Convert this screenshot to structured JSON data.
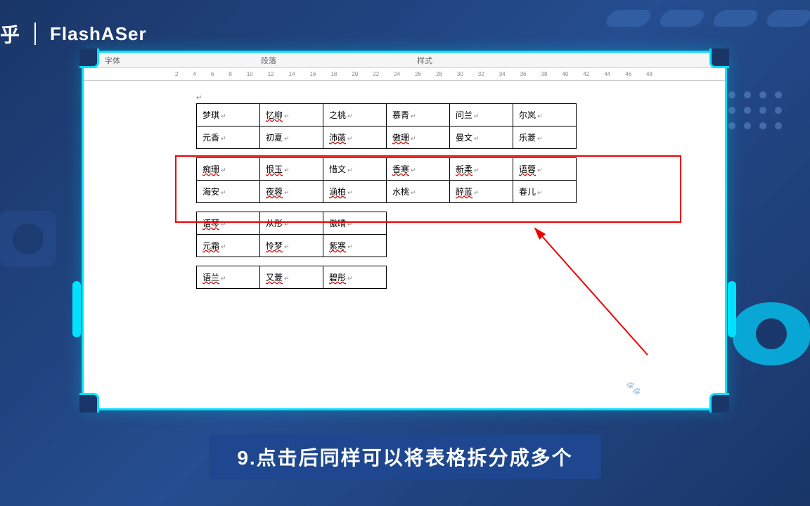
{
  "header": {
    "logo": "乎",
    "author": "FlashASer"
  },
  "ribbon": {
    "t1": "字体",
    "t2": "段落",
    "t3": "样式"
  },
  "ruler": [
    "2",
    "4",
    "6",
    "8",
    "10",
    "12",
    "14",
    "16",
    "18",
    "20",
    "22",
    "24",
    "26",
    "28",
    "30",
    "32",
    "34",
    "36",
    "38",
    "40",
    "42",
    "44",
    "46",
    "48"
  ],
  "table1_r1": [
    "梦琪",
    "忆柳",
    "之桃",
    "慕青",
    "问兰",
    "尔岚"
  ],
  "table1_r2": [
    "元香",
    "初夏",
    "沛菡",
    "傲珊",
    "曼文",
    "乐菱"
  ],
  "table2_r1": [
    "痴珊",
    "恨玉",
    "惜文",
    "香寒",
    "新柔",
    "语蓉"
  ],
  "table2_r2": [
    "海安",
    "夜蓉",
    "涵柏",
    "水桃",
    "醉蓝",
    "春儿"
  ],
  "table3_r1": [
    "语琴",
    "从彤",
    "傲晴"
  ],
  "table3_r2": [
    "元霜",
    "怜梦",
    "紫寒"
  ],
  "table4_r1": [
    "语兰",
    "又菱",
    "碧彤"
  ],
  "watermark": "Baidu 经验",
  "caption": "9.点击后同样可以将表格拆分成多个"
}
